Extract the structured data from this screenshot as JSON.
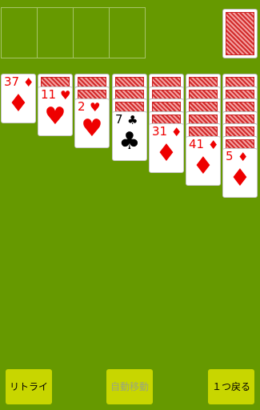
{
  "foundation": {
    "slots": 4
  },
  "stock": {
    "card": "card-back"
  },
  "tableau": [
    {
      "cards": [
        {
          "rank": "37",
          "suit": "♦",
          "color": "red",
          "face": true
        }
      ]
    },
    {
      "cards": [
        {
          "face": false
        },
        {
          "rank": "11",
          "suit": "♥",
          "color": "red",
          "face": true
        }
      ]
    },
    {
      "cards": [
        {
          "face": false
        },
        {
          "face": false
        },
        {
          "rank": "2",
          "suit": "♥",
          "color": "red",
          "face": true
        }
      ]
    },
    {
      "cards": [
        {
          "face": false
        },
        {
          "face": false
        },
        {
          "face": false
        },
        {
          "rank": "7",
          "suit": "♣",
          "color": "black",
          "face": true
        }
      ]
    },
    {
      "cards": [
        {
          "face": false
        },
        {
          "face": false
        },
        {
          "face": false
        },
        {
          "face": false
        },
        {
          "rank": "31",
          "suit": "♦",
          "color": "red",
          "face": true
        }
      ]
    },
    {
      "cards": [
        {
          "face": false
        },
        {
          "face": false
        },
        {
          "face": false
        },
        {
          "face": false
        },
        {
          "face": false
        },
        {
          "rank": "41",
          "suit": "♦",
          "color": "red",
          "face": true
        }
      ]
    },
    {
      "cards": [
        {
          "face": false
        },
        {
          "face": false
        },
        {
          "face": false
        },
        {
          "face": false
        },
        {
          "face": false
        },
        {
          "face": false
        },
        {
          "rank": "5",
          "suit": "♦",
          "color": "red",
          "face": true
        }
      ]
    }
  ],
  "buttons": {
    "retry": "リトライ",
    "auto_move": "自動移動",
    "undo": "１つ戻る"
  },
  "colors": {
    "felt": "#669900",
    "button": "#c8d600",
    "suit_red": "#ee0000"
  }
}
